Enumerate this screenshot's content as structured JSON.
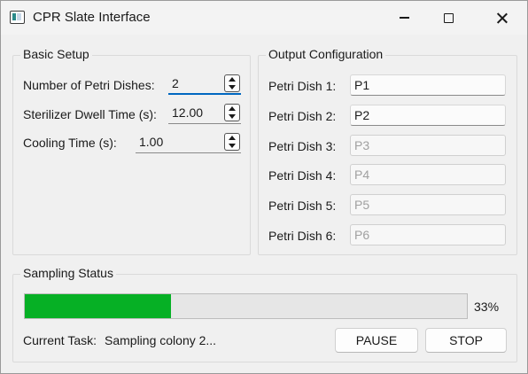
{
  "window": {
    "title": "CPR Slate Interface",
    "controls": [
      "minimize",
      "maximize",
      "close"
    ]
  },
  "icons": {
    "app": "app-window-icon",
    "minimize": "minimize-icon",
    "maximize": "maximize-icon",
    "close": "close-icon"
  },
  "basic_setup": {
    "title": "Basic Setup",
    "petri_dishes": {
      "label": "Number of Petri Dishes:",
      "value": "2"
    },
    "dwell_time": {
      "label": "Sterilizer Dwell Time (s):",
      "value": "12.00"
    },
    "cooling_time": {
      "label": "Cooling Time (s):",
      "value": "1.00"
    }
  },
  "output_config": {
    "title": "Output Configuration",
    "dishes": [
      {
        "label": "Petri Dish 1:",
        "value": "P1",
        "enabled": true
      },
      {
        "label": "Petri Dish 2:",
        "value": "P2",
        "enabled": true
      },
      {
        "label": "Petri Dish 3:",
        "value": "P3",
        "enabled": false
      },
      {
        "label": "Petri Dish 4:",
        "value": "P4",
        "enabled": false
      },
      {
        "label": "Petri Dish 5:",
        "value": "P5",
        "enabled": false
      },
      {
        "label": "Petri Dish 6:",
        "value": "P6",
        "enabled": false
      }
    ]
  },
  "sampling_status": {
    "title": "Sampling Status",
    "progress_percent": 33,
    "progress_text": "33%",
    "current_task_label": "Current Task:",
    "current_task_value": "Sampling colony 2...",
    "pause_label": "PAUSE",
    "stop_label": "STOP"
  },
  "colors": {
    "progress_fill": "#06b025",
    "focus_accent": "#0067c0"
  }
}
